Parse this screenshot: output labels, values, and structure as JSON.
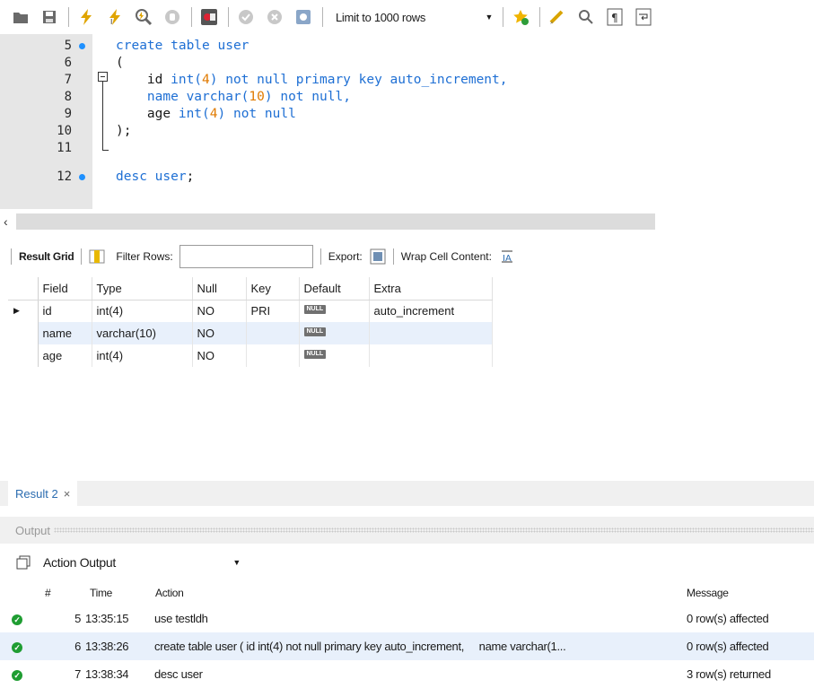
{
  "toolbar": {
    "icons": [
      "folder-icon",
      "save-icon",
      "execute-icon",
      "execute-current-icon",
      "explain-icon",
      "stop-icon",
      "toggle-continue-on-error-icon",
      "commit-icon",
      "rollback-icon",
      "autocommit-icon",
      "favorite-icon",
      "beautify-icon",
      "find-icon",
      "invisible-chars-icon",
      "wrap-icon"
    ],
    "limit_select": "Limit to 1000 rows"
  },
  "editor": {
    "lines": [
      {
        "n": "5",
        "dot": true,
        "segments": [
          {
            "t": "kw",
            "v": "create table user"
          }
        ]
      },
      {
        "n": "6",
        "dot": false,
        "segments": [
          {
            "t": "plain",
            "v": "("
          }
        ]
      },
      {
        "n": "7",
        "dot": false,
        "segments": [
          {
            "t": "plain",
            "v": "    id "
          },
          {
            "t": "kw",
            "v": "int("
          },
          {
            "t": "num",
            "v": "4"
          },
          {
            "t": "kw",
            "v": ") not null primary key auto_increment,"
          }
        ]
      },
      {
        "n": "8",
        "dot": false,
        "segments": [
          {
            "t": "plain",
            "v": "    "
          },
          {
            "t": "kw",
            "v": "name varchar("
          },
          {
            "t": "num",
            "v": "10"
          },
          {
            "t": "kw",
            "v": ") not null,"
          }
        ]
      },
      {
        "n": "9",
        "dot": false,
        "segments": [
          {
            "t": "plain",
            "v": "    age "
          },
          {
            "t": "kw",
            "v": "int("
          },
          {
            "t": "num",
            "v": "4"
          },
          {
            "t": "kw",
            "v": ") not null"
          }
        ]
      },
      {
        "n": "10",
        "dot": false,
        "segments": [
          {
            "t": "plain",
            "v": ");"
          }
        ]
      },
      {
        "n": "11",
        "dot": false,
        "segments": []
      },
      {
        "n": "12",
        "dot": true,
        "segments": [
          {
            "t": "kw",
            "v": "desc user"
          },
          {
            "t": "plain",
            "v": ";"
          }
        ]
      }
    ]
  },
  "result_grid": {
    "label": "Result Grid",
    "filter_label": "Filter Rows:",
    "export_label": "Export:",
    "wrap_label": "Wrap Cell Content:",
    "columns": [
      "Field",
      "Type",
      "Null",
      "Key",
      "Default",
      "Extra"
    ],
    "null_badge": "NULL",
    "rows": [
      {
        "field": "id",
        "type": "int(4)",
        "null": "NO",
        "key": "PRI",
        "extra": "auto_increment"
      },
      {
        "field": "name",
        "type": "varchar(10)",
        "null": "NO",
        "key": "",
        "extra": ""
      },
      {
        "field": "age",
        "type": "int(4)",
        "null": "NO",
        "key": "",
        "extra": ""
      }
    ]
  },
  "result_tab": {
    "label": "Result 2",
    "close": "×"
  },
  "output": {
    "header": "Output",
    "select": "Action Output",
    "columns": {
      "num": "#",
      "time": "Time",
      "action": "Action",
      "message": "Message"
    },
    "rows": [
      {
        "num": "5",
        "time": "13:35:15",
        "action": "use testldh",
        "message": "0 row(s) affected"
      },
      {
        "num": "6",
        "time": "13:38:26",
        "action": "create table user ( id int(4) not null primary key auto_increment,     name varchar(1...",
        "message": "0 row(s) affected"
      },
      {
        "num": "7",
        "time": "13:38:34",
        "action": "desc user",
        "message": "3 row(s) returned"
      }
    ]
  },
  "colors": {
    "keyword": "#1e6fd4",
    "number": "#e07a00",
    "success": "#1f9d32",
    "selection": "#e8f0fb"
  }
}
